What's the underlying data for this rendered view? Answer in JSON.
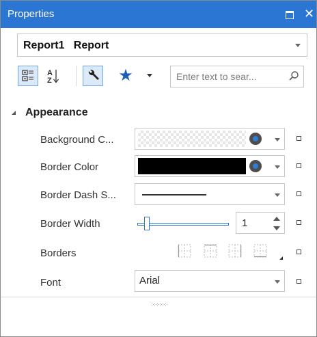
{
  "window": {
    "title": "Properties"
  },
  "object_selector": {
    "value": "Report1   Report"
  },
  "toolbar": {
    "categorized": "categorized-icon",
    "alphabetical": "sort-az-icon",
    "properties": "wrench-icon",
    "favorites": "star-icon"
  },
  "search": {
    "placeholder": "Enter text to sear..."
  },
  "category": {
    "name": "Appearance"
  },
  "properties": [
    {
      "label": "Background C...",
      "value_color": "transparent"
    },
    {
      "label": "Border Color",
      "value_color": "#000000"
    },
    {
      "label": "Border Dash S...",
      "value_style": "solid"
    },
    {
      "label": "Border Width",
      "value": "1"
    },
    {
      "label": "Borders"
    },
    {
      "label": "Font",
      "value": "Arial"
    }
  ],
  "colors": {
    "accent": "#2b76d2",
    "title_bg": "#2b76d2",
    "star": "#1e5fb5"
  }
}
